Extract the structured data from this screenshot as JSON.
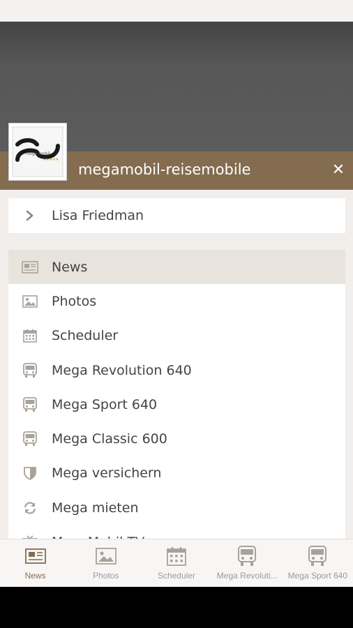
{
  "app": {
    "title": "megamobil-reisemobile"
  },
  "logo": {
    "text": "mega mobil",
    "stars": "★★★★★"
  },
  "user": {
    "name": "Lisa Friedman"
  },
  "menu": {
    "items": [
      {
        "label": "News",
        "icon": "newspaper-icon",
        "active": true
      },
      {
        "label": "Photos",
        "icon": "image-icon"
      },
      {
        "label": "Scheduler",
        "icon": "calendar-icon"
      },
      {
        "label": "Mega Revolution 640",
        "icon": "bus-icon"
      },
      {
        "label": "Mega Sport 640",
        "icon": "bus-icon"
      },
      {
        "label": "Mega Classic 600",
        "icon": "bus-icon"
      },
      {
        "label": "Mega versichern",
        "icon": "shield-icon"
      },
      {
        "label": "Mega mieten",
        "icon": "refresh-icon"
      },
      {
        "label": "MegaMobil TV",
        "icon": "tv-icon"
      }
    ]
  },
  "tabs": [
    {
      "label": "News",
      "icon": "newspaper-icon",
      "active": true
    },
    {
      "label": "Photos",
      "icon": "image-icon"
    },
    {
      "label": "Scheduler",
      "icon": "calendar-icon"
    },
    {
      "label": "Mega Revoluti...",
      "icon": "bus-icon"
    },
    {
      "label": "Mega Sport 640",
      "icon": "bus-icon"
    }
  ],
  "colors": {
    "accent": "#846c50",
    "menu_active": "#e8e3dd",
    "icon_gray": "#a9a29b"
  }
}
